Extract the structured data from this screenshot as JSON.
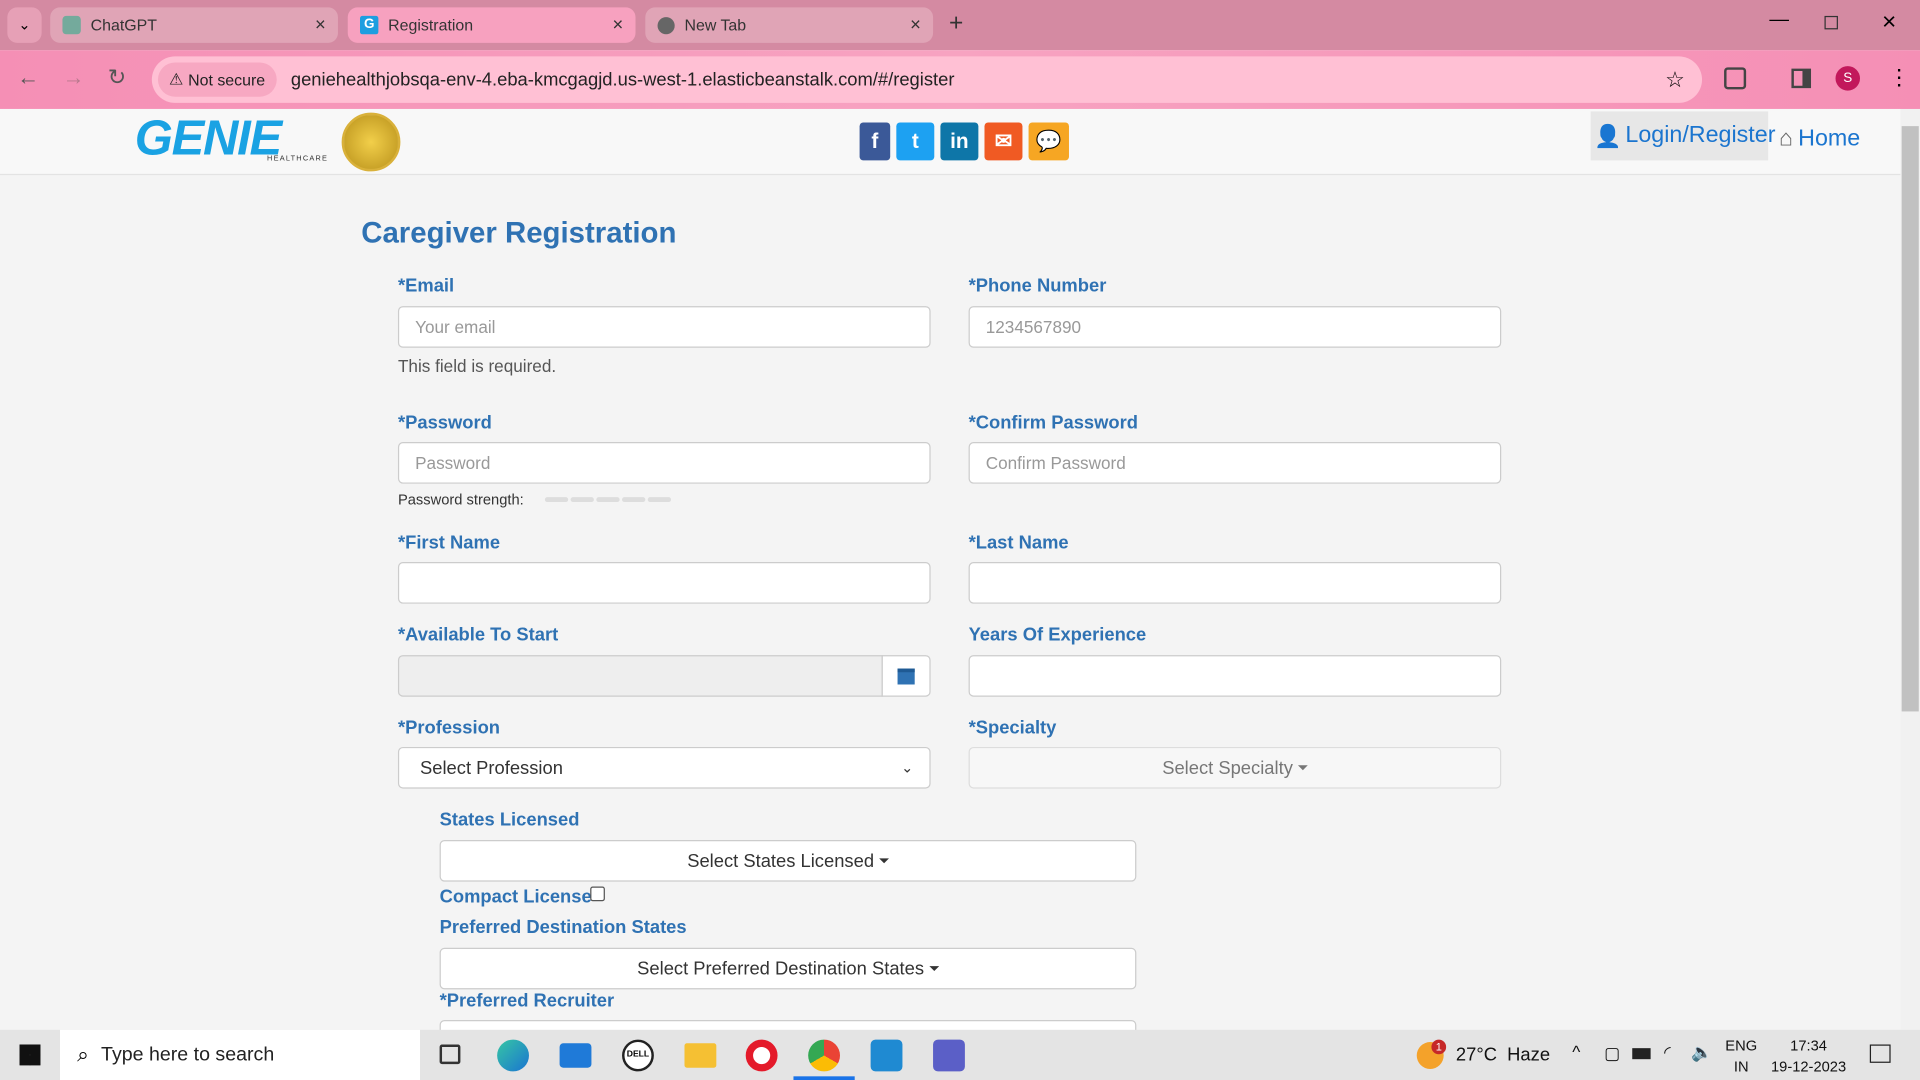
{
  "browser": {
    "tabs": [
      {
        "label": "ChatGPT",
        "icon": "chatgpt-icon"
      },
      {
        "label": "Registration",
        "icon": "genie-favicon",
        "active": true
      },
      {
        "label": "New Tab",
        "icon": "globe-icon"
      }
    ],
    "security_label": "Not secure",
    "url": "geniehealthjobsqa-env-4.eba-kmcgagjd.us-west-1.elasticbeanstalk.com/#/register",
    "profile_initial": "S"
  },
  "header": {
    "logo_sub": "HEALTHCARE",
    "social": [
      "facebook-icon",
      "twitter-icon",
      "linkedin-icon",
      "email-icon",
      "chat-icon"
    ],
    "login_label": "Login/Register",
    "home_label": "Home"
  },
  "form": {
    "title": "Caregiver Registration",
    "email": {
      "label": "*Email",
      "placeholder": "Your email",
      "error": "This field is required."
    },
    "phone": {
      "label": "*Phone Number",
      "placeholder": "1234567890"
    },
    "password": {
      "label": "*Password",
      "placeholder": "Password",
      "strength_label": "Password strength:",
      "strength_level": 0
    },
    "confirm": {
      "label": "*Confirm Password",
      "placeholder": "Confirm Password"
    },
    "first_name": {
      "label": "*First Name"
    },
    "last_name": {
      "label": "*Last Name"
    },
    "available": {
      "label": "*Available To Start"
    },
    "experience": {
      "label": "Years Of Experience"
    },
    "profession": {
      "label": "*Profession",
      "value": "Select Profession"
    },
    "specialty": {
      "label": "*Specialty",
      "value": "Select Specialty"
    },
    "states": {
      "label": "States Licensed",
      "value": "Select States Licensed"
    },
    "compact": {
      "label": "Compact License",
      "checked": false
    },
    "destination": {
      "label": "Preferred Destination States",
      "value": "Select Preferred Destination States"
    },
    "recruiter": {
      "label": "*Preferred Recruiter"
    }
  },
  "taskbar": {
    "search_placeholder": "Type here to search",
    "weather": "27°C  Haze",
    "weather_badge": "1",
    "lang1": "ENG",
    "lang2": "IN",
    "time": "17:34",
    "date": "19-12-2023"
  },
  "colors": {
    "accent": "#2f72b3",
    "tab_bar": "#d48aa2",
    "toolbar": "#f58fb5"
  }
}
